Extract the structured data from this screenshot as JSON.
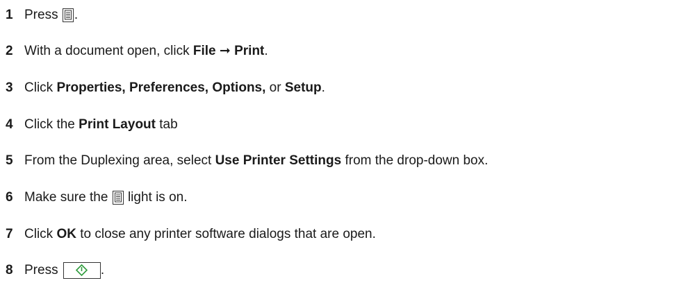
{
  "steps": [
    {
      "num": "1",
      "parts": [
        {
          "t": "Press "
        },
        {
          "icon": "duplex-button-icon"
        },
        {
          "t": "."
        }
      ]
    },
    {
      "num": "2",
      "parts": [
        {
          "t": "With a document open, click "
        },
        {
          "b": "File"
        },
        {
          "t": " ➞ "
        },
        {
          "b": "Print"
        },
        {
          "t": "."
        }
      ]
    },
    {
      "num": "3",
      "parts": [
        {
          "t": "Click "
        },
        {
          "b": "Properties, Preferences, Options,"
        },
        {
          "t": " or "
        },
        {
          "b": "Setup"
        },
        {
          "t": "."
        }
      ]
    },
    {
      "num": "4",
      "parts": [
        {
          "t": "Click the "
        },
        {
          "b": "Print Layout"
        },
        {
          "t": " tab"
        }
      ]
    },
    {
      "num": "5",
      "parts": [
        {
          "t": "From the Duplexing area, select "
        },
        {
          "b": "Use Printer Settings"
        },
        {
          "t": " from the drop-down box."
        }
      ]
    },
    {
      "num": "6",
      "parts": [
        {
          "t": "Make sure the "
        },
        {
          "icon": "duplex-light-icon"
        },
        {
          "t": " light is on."
        }
      ]
    },
    {
      "num": "7",
      "parts": [
        {
          "t": "Click "
        },
        {
          "b": "OK"
        },
        {
          "t": " to close any printer software dialogs that are open."
        }
      ]
    },
    {
      "num": "8",
      "parts": [
        {
          "t": "Press "
        },
        {
          "icon": "start-button-icon"
        },
        {
          "t": "."
        }
      ]
    }
  ]
}
